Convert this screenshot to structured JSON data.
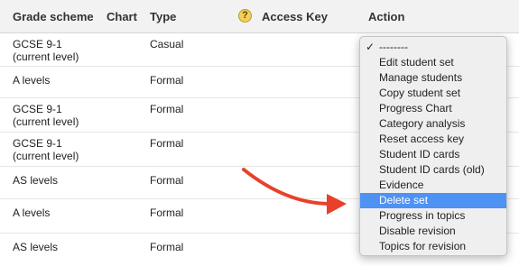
{
  "header": {
    "grade_scheme": "Grade scheme",
    "chart": "Chart",
    "type": "Type",
    "help_icon": "question-mark-icon",
    "help_symbol": "?",
    "access_key": "Access Key",
    "action": "Action"
  },
  "rows": [
    {
      "grade_scheme": [
        "GCSE 9-1",
        "(current level)"
      ],
      "type": "Casual"
    },
    {
      "grade_scheme": [
        "A levels"
      ],
      "type": "Formal"
    },
    {
      "grade_scheme": [
        "GCSE 9-1",
        "(current level)"
      ],
      "type": "Formal"
    },
    {
      "grade_scheme": [
        "GCSE 9-1",
        "(current level)"
      ],
      "type": "Formal"
    },
    {
      "grade_scheme": [
        "AS levels"
      ],
      "type": "Formal"
    },
    {
      "grade_scheme": [
        "A levels"
      ],
      "type": "Formal"
    },
    {
      "grade_scheme": [
        "AS levels"
      ],
      "type": "Formal"
    }
  ],
  "action_menu": {
    "checkmark": "✓",
    "selected_index": 0,
    "highlighted_index": 10,
    "items": [
      "--------",
      "Edit student set",
      "Manage students",
      "Copy student set",
      "Progress Chart",
      "Category analysis",
      "Reset access key",
      "Student ID cards",
      "Student ID cards (old)",
      "Evidence",
      "Delete set",
      "Progress in topics",
      "Disable revision",
      "Topics for revision"
    ]
  },
  "annotation": {
    "arrow_icon": "red-curved-arrow-icon",
    "arrow_color": "#e8402a"
  },
  "colors": {
    "header_bg": "#f2f2f2",
    "menu_bg": "#efefef",
    "menu_highlight": "#4e92f3",
    "help_icon_bg": "#f3cf5b"
  }
}
